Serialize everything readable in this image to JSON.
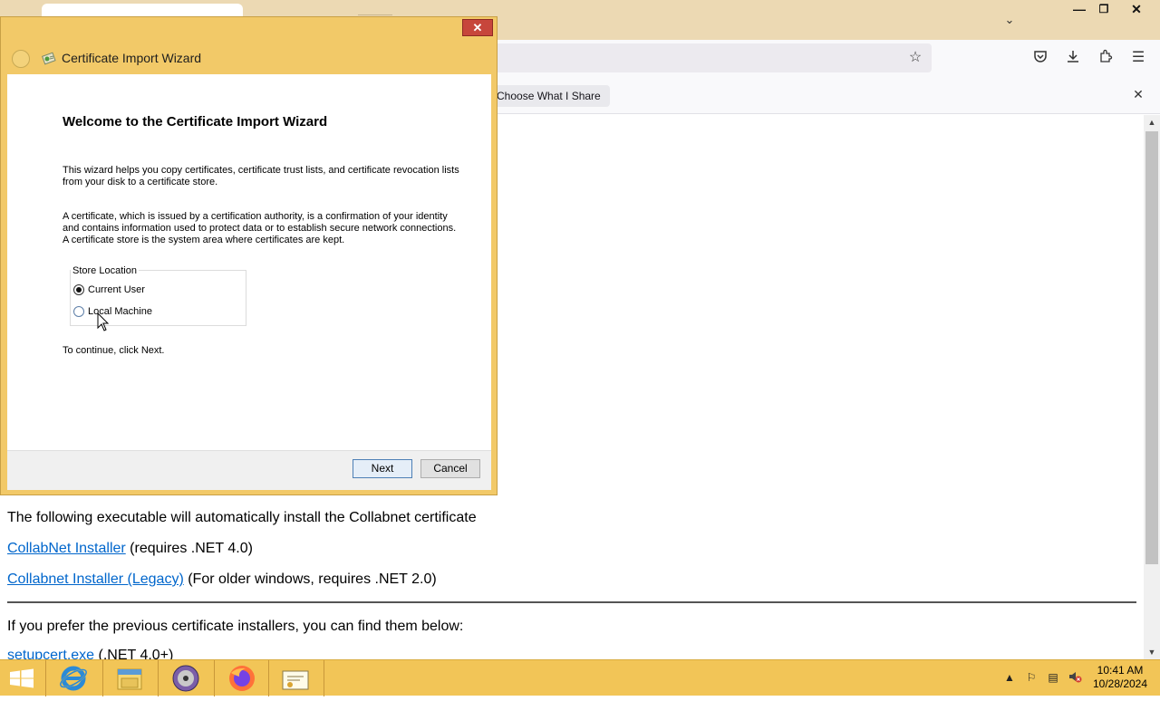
{
  "browser": {
    "notification": {
      "choose_label": "Choose What I Share"
    }
  },
  "page": {
    "intro": "The following executable will automatically install the Collabnet certificate",
    "links": [
      {
        "label": "CollabNet Installer",
        "note": " (requires .NET 4.0)"
      },
      {
        "label": "Collabnet Installer (Legacy)",
        "note": " (For older windows, requires .NET 2.0)"
      },
      {
        "label": "setupcert.exe",
        "note": " (.NET 4.0+)"
      }
    ],
    "prefer_text": "If you prefer the previous certificate installers, you can find them below:"
  },
  "dialog": {
    "title": "Certificate Import Wizard",
    "close_glyph": "✕",
    "heading": "Welcome to the Certificate Import Wizard",
    "para1": "This wizard helps you copy certificates, certificate trust lists, and certificate revocation lists from your disk to a certificate store.",
    "para2": "A certificate, which is issued by a certification authority, is a confirmation of your identity and contains information used to protect data or to establish secure network connections. A certificate store is the system area where certificates are kept.",
    "store_location": {
      "legend": "Store Location",
      "options": [
        {
          "label": "Current User",
          "selected": true
        },
        {
          "label": "Local Machine",
          "selected": false
        }
      ]
    },
    "continue_text": "To continue, click Next.",
    "next_label": "Next",
    "cancel_label": "Cancel"
  },
  "taskbar": {
    "apps": [
      "start-icon",
      "internet-explorer-icon",
      "file-explorer-icon",
      "media-center-icon",
      "firefox-icon",
      "certificate-wizard-icon"
    ],
    "tray_icons": [
      "show-hidden-icons-arrow",
      "action-center-flag-icon",
      "network-icon",
      "volume-muted-icon"
    ],
    "time": "10:41 AM",
    "date": "10/28/2024"
  },
  "colors": {
    "window_frame": "#f2c968",
    "taskbar": "#f2c557",
    "link": "#0066cc",
    "close_button": "#c7463b"
  }
}
